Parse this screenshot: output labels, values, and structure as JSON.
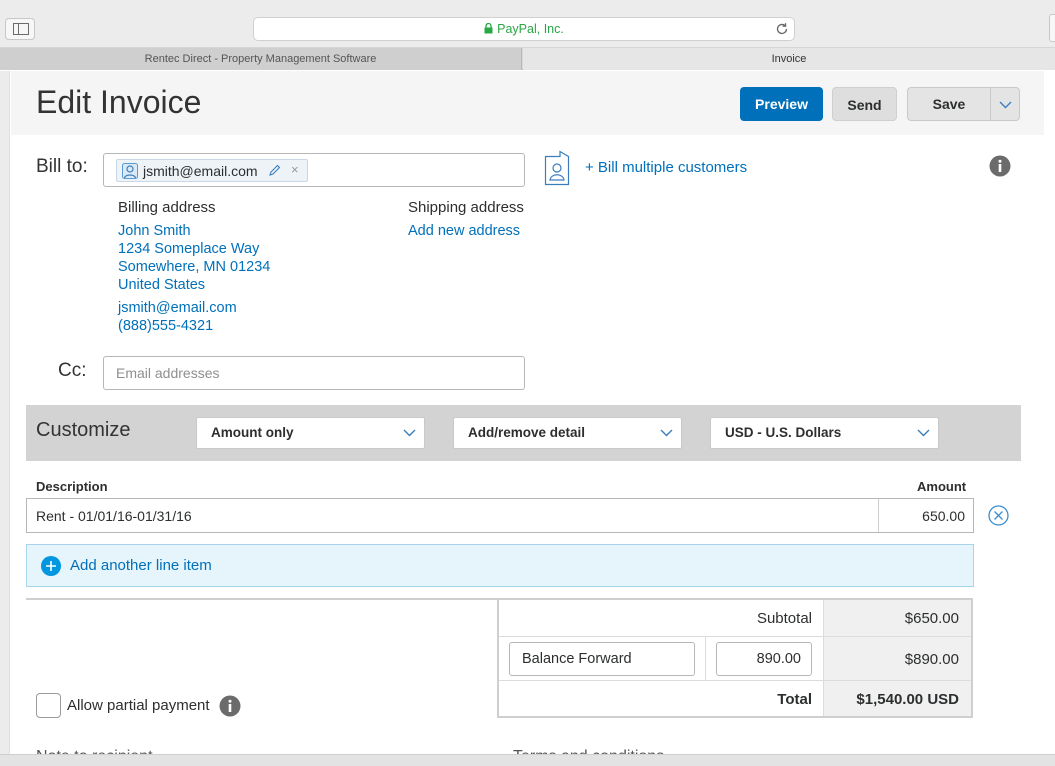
{
  "browser": {
    "url_text": "PayPal, Inc.",
    "tabs": [
      {
        "label": "Rentec Direct - Property Management Software"
      },
      {
        "label": "Invoice"
      }
    ]
  },
  "header": {
    "title": "Edit Invoice",
    "preview_label": "Preview",
    "send_label": "Send",
    "save_label": "Save"
  },
  "bill_to": {
    "label": "Bill to:",
    "recipient_email": "jsmith@email.com",
    "remove_glyph": "×",
    "bill_multiple_label": "+ Bill multiple customers",
    "billing_heading": "Billing address",
    "billing_lines": [
      "John Smith",
      "1234 Someplace Way",
      "Somewhere, MN 01234",
      "United States",
      "jsmith@email.com",
      "(888)555-4321"
    ],
    "shipping_heading": "Shipping address",
    "add_address_label": "Add new address"
  },
  "cc": {
    "label": "Cc:",
    "placeholder": "Email addresses",
    "value": ""
  },
  "customize": {
    "label": "Customize",
    "selects": [
      {
        "value": "Amount only"
      },
      {
        "value": "Add/remove detail"
      },
      {
        "value": "USD - U.S. Dollars"
      }
    ]
  },
  "items": {
    "description_header": "Description",
    "amount_header": "Amount",
    "rows": [
      {
        "description": "Rent - 01/01/16-01/31/16",
        "amount": "650.00"
      }
    ],
    "add_line_label": "Add another line item"
  },
  "totals": {
    "subtotal_label": "Subtotal",
    "subtotal_value": "$650.00",
    "adjustment_label_value": "Balance Forward",
    "adjustment_amount_value": "890.00",
    "adjustment_value": "$890.00",
    "total_label": "Total",
    "total_value": "$1,540.00 USD"
  },
  "partial_payment": {
    "label": "Allow partial payment",
    "checked": false
  },
  "footer_cut": {
    "notes_heading": "Note to recipient",
    "terms_heading": "Terms and conditions"
  },
  "colors": {
    "brand_blue": "#0070ba",
    "link_blue": "#0070ba",
    "secure_green": "#28a745",
    "customize_band": "#d3d3d3"
  },
  "icons": {
    "sidebar": "sidebar-icon",
    "lock": "lock-icon",
    "reload": "reload-icon",
    "caret": "chevron-down-icon",
    "user": "user-icon",
    "edit": "pencil-icon",
    "contact": "contact-card-icon",
    "info": "info-icon",
    "remove": "close-circle-icon",
    "add": "plus-circle-icon"
  }
}
